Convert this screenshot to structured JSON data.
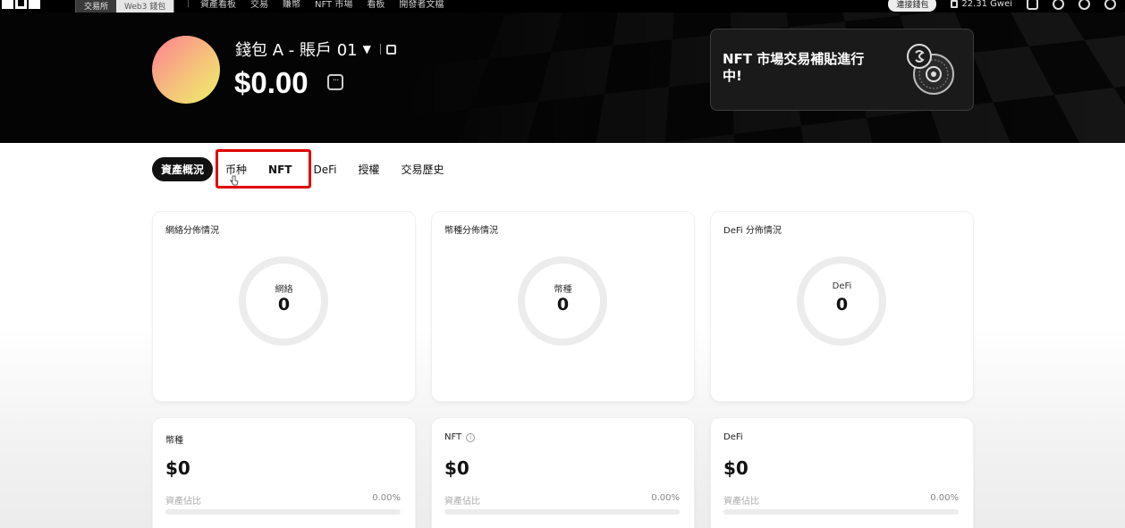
{
  "topnav": {
    "mode_tabs": [
      "交易所",
      "Web3 錢包"
    ],
    "links": [
      "資產看板",
      "交易",
      "賺幣",
      "NFT 市場",
      "看板",
      "開發者文檔"
    ],
    "connect_label": "連接錢包",
    "gas_label": "22.31 Gwei"
  },
  "hero": {
    "wallet_name": "錢包 A - 賬戶 01",
    "balance": "$0.00",
    "promo_text": "NFT 市場交易補貼進行中!"
  },
  "tabs": [
    "資產概況",
    "币种",
    "NFT",
    "DeFi",
    "授權",
    "交易歷史"
  ],
  "distribution_cards": [
    {
      "title": "網絡分佈情況",
      "center_label": "網絡",
      "center_value": "0"
    },
    {
      "title": "幣種分佈情況",
      "center_label": "幣種",
      "center_value": "0"
    },
    {
      "title": "DeFi 分佈情況",
      "center_label": "DeFi",
      "center_value": "0"
    }
  ],
  "stat_cards": [
    {
      "title": "幣種",
      "value": "$0",
      "share_label": "資產佔比",
      "share_pct": "0.00%"
    },
    {
      "title": "NFT",
      "value": "$0",
      "share_label": "資產佔比",
      "share_pct": "0.00%"
    },
    {
      "title": "DeFi",
      "value": "$0",
      "share_label": "資產佔比",
      "share_pct": "0.00%"
    }
  ],
  "colors": {
    "hero_bg": "#060606",
    "highlight": "#e10000",
    "avatar_from": "#ff7f94",
    "avatar_to": "#eef06a"
  }
}
